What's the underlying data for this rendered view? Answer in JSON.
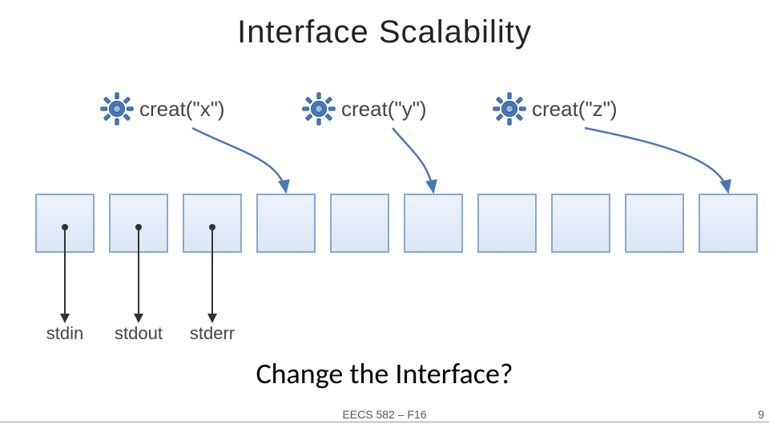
{
  "title": "Interface Scalability",
  "calls": [
    {
      "label": "creat(\"x\")"
    },
    {
      "label": "creat(\"y\")"
    },
    {
      "label": "creat(\"z\")"
    }
  ],
  "std_labels": {
    "stdin": "stdin",
    "stdout": "stdout",
    "stderr": "stderr"
  },
  "box_count": 10,
  "subtitle": "Change the Interface?",
  "footer": {
    "center": "EECS 582 – F16",
    "right": "9"
  },
  "colors": {
    "box_border": "#8aa8cf",
    "box_fill_top": "#eef3fa",
    "box_fill_bottom": "#dbe6f4",
    "arrow_blue": "#4a77b4",
    "gear_blue": "#4a77b4"
  }
}
